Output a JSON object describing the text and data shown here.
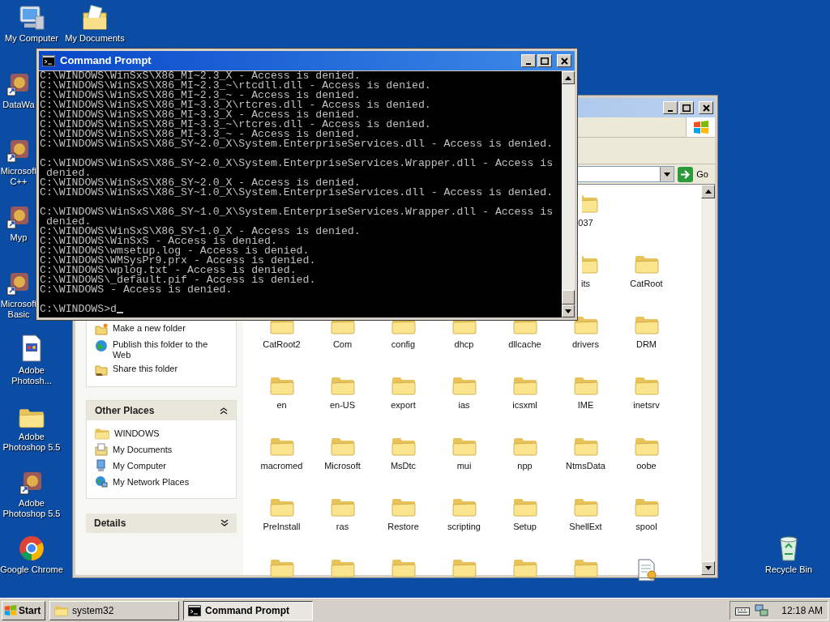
{
  "desktop": {
    "left_column": [
      {
        "kind": "computer",
        "label": "My Computer"
      },
      {
        "kind": "app",
        "label": "DataWa"
      },
      {
        "kind": "app",
        "label": "Microsoft C++"
      },
      {
        "kind": "app",
        "label": "Myp"
      },
      {
        "kind": "app",
        "label": "Microsoft Basic"
      },
      {
        "kind": "document",
        "label": "Adobe Photosh..."
      },
      {
        "kind": "folder",
        "label": "Adobe Photoshop 5.5"
      },
      {
        "kind": "app",
        "label": "Adobe Photoshop 5.5"
      },
      {
        "kind": "chrome",
        "label": "Google Chrome"
      }
    ],
    "second_column": [
      {
        "kind": "documents",
        "label": "My Documents"
      }
    ],
    "right_column": [
      {
        "kind": "recycle",
        "label": "Recycle Bin"
      }
    ]
  },
  "cmd": {
    "title": "Command Prompt",
    "blocks": [
      [
        "C:\\WINDOWS\\WinSxS\\X86_MI~2.3_X - Access is denied.",
        "C:\\WINDOWS\\WinSxS\\X86_MI~2.3_~\\rtcdll.dll - Access is denied.",
        "C:\\WINDOWS\\WinSxS\\X86_MI~2.3_~ - Access is denied.",
        "C:\\WINDOWS\\WinSxS\\X86_MI~3.3_X\\rtcres.dll - Access is denied.",
        "C:\\WINDOWS\\WinSxS\\X86_MI~3.3_X - Access is denied.",
        "C:\\WINDOWS\\WinSxS\\X86_MI~3.3_~\\rtcres.dll - Access is denied.",
        "C:\\WINDOWS\\WinSxS\\X86_MI~3.3_~ - Access is denied.",
        "C:\\WINDOWS\\WinSxS\\X86_SY~2.0_X\\System.EnterpriseServices.dll - Access is denied."
      ],
      [
        "C:\\WINDOWS\\WinSxS\\X86_SY~2.0_X\\System.EnterpriseServices.Wrapper.dll - Access is",
        " denied.",
        "C:\\WINDOWS\\WinSxS\\X86_SY~2.0_X - Access is denied.",
        "C:\\WINDOWS\\WinSxS\\X86_SY~1.0_X\\System.EnterpriseServices.dll - Access is denied."
      ],
      [
        "C:\\WINDOWS\\WinSxS\\X86_SY~1.0_X\\System.EnterpriseServices.Wrapper.dll - Access is",
        " denied.",
        "C:\\WINDOWS\\WinSxS\\X86_SY~1.0_X - Access is denied.",
        "C:\\WINDOWS\\WinSxS - Access is denied.",
        "C:\\WINDOWS\\wmsetup.log - Access is denied.",
        "C:\\WINDOWS\\WMSysPr9.prx - Access is denied.",
        "C:\\WINDOWS\\wplog.txt - Access is denied.",
        "C:\\WINDOWS\\_default.pif - Access is denied.",
        "C:\\WINDOWS - Access is denied."
      ]
    ],
    "prompt": "C:\\WINDOWS>d"
  },
  "explorer": {
    "go_button": "Go",
    "tasks": [
      {
        "kind": "new-folder",
        "label": "Make a new folder"
      },
      {
        "kind": "publish",
        "label": "Publish this folder to the Web"
      },
      {
        "kind": "share",
        "label": "Share this folder"
      }
    ],
    "other_places": {
      "title": "Other Places",
      "expanded": true,
      "items": [
        {
          "kind": "folder",
          "label": "WINDOWS"
        },
        {
          "kind": "documents",
          "label": "My Documents"
        },
        {
          "kind": "computer",
          "label": "My Computer"
        },
        {
          "kind": "network",
          "label": "My Network Places"
        }
      ]
    },
    "details": {
      "title": "Details",
      "expanded": false
    },
    "folder_rows": [
      [
        null,
        null,
        null,
        null,
        null,
        {
          "kind": "folder",
          "label": "037"
        },
        null
      ],
      [
        null,
        null,
        null,
        null,
        null,
        {
          "kind": "folder",
          "label": "its"
        },
        {
          "kind": "folder",
          "label": "CatRoot"
        }
      ],
      [
        {
          "kind": "folder",
          "label": "CatRoot2"
        },
        {
          "kind": "folder",
          "label": "Com"
        },
        {
          "kind": "folder",
          "label": "config"
        },
        {
          "kind": "folder",
          "label": "dhcp"
        },
        {
          "kind": "folder",
          "label": "dllcache"
        },
        {
          "kind": "folder",
          "label": "drivers"
        },
        {
          "kind": "folder",
          "label": "DRM"
        }
      ],
      [
        {
          "kind": "folder",
          "label": "en"
        },
        {
          "kind": "folder",
          "label": "en-US"
        },
        {
          "kind": "folder",
          "label": "export"
        },
        {
          "kind": "folder",
          "label": "ias"
        },
        {
          "kind": "folder",
          "label": "icsxml"
        },
        {
          "kind": "folder",
          "label": "IME"
        },
        {
          "kind": "folder",
          "label": "inetsrv"
        }
      ],
      [
        {
          "kind": "folder",
          "label": "macromed"
        },
        {
          "kind": "folder",
          "label": "Microsoft"
        },
        {
          "kind": "folder",
          "label": "MsDtc"
        },
        {
          "kind": "folder",
          "label": "mui"
        },
        {
          "kind": "folder",
          "label": "npp"
        },
        {
          "kind": "folder",
          "label": "NtmsData"
        },
        {
          "kind": "folder",
          "label": "oobe"
        }
      ],
      [
        {
          "kind": "folder",
          "label": "PreInstall"
        },
        {
          "kind": "folder",
          "label": "ras"
        },
        {
          "kind": "folder",
          "label": "Restore"
        },
        {
          "kind": "folder",
          "label": "scripting"
        },
        {
          "kind": "folder",
          "label": "Setup"
        },
        {
          "kind": "folder",
          "label": "ShellExt"
        },
        {
          "kind": "folder",
          "label": "spool"
        }
      ],
      [
        {
          "kind": "folder"
        },
        {
          "kind": "folder"
        },
        {
          "kind": "folder"
        },
        {
          "kind": "folder"
        },
        {
          "kind": "folder"
        },
        {
          "kind": "folder"
        },
        {
          "kind": "file"
        }
      ]
    ]
  },
  "taskbar": {
    "start": "Start",
    "tasks": [
      {
        "kind": "folder",
        "label": "system32",
        "selected": false
      },
      {
        "kind": "console",
        "label": "Command Prompt",
        "selected": true
      }
    ],
    "clock": "12:18 AM"
  }
}
